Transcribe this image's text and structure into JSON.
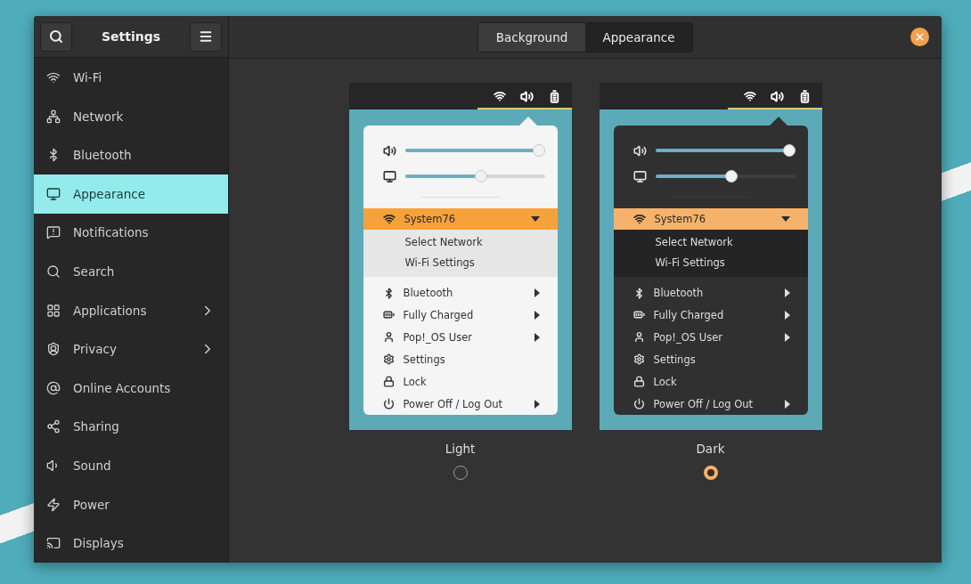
{
  "window": {
    "title": "Settings"
  },
  "sidebar": {
    "items": [
      {
        "label": "Wi-Fi",
        "selected": false,
        "has_submenu": false
      },
      {
        "label": "Network",
        "selected": false,
        "has_submenu": false
      },
      {
        "label": "Bluetooth",
        "selected": false,
        "has_submenu": false
      },
      {
        "label": "Appearance",
        "selected": true,
        "has_submenu": false
      },
      {
        "label": "Notifications",
        "selected": false,
        "has_submenu": false
      },
      {
        "label": "Search",
        "selected": false,
        "has_submenu": false
      },
      {
        "label": "Applications",
        "selected": false,
        "has_submenu": true
      },
      {
        "label": "Privacy",
        "selected": false,
        "has_submenu": true
      },
      {
        "label": "Online Accounts",
        "selected": false,
        "has_submenu": false
      },
      {
        "label": "Sharing",
        "selected": false,
        "has_submenu": false
      },
      {
        "label": "Sound",
        "selected": false,
        "has_submenu": false
      },
      {
        "label": "Power",
        "selected": false,
        "has_submenu": false
      },
      {
        "label": "Displays",
        "selected": false,
        "has_submenu": false
      }
    ]
  },
  "tabs": [
    {
      "label": "Background",
      "selected": false
    },
    {
      "label": "Appearance",
      "selected": true
    }
  ],
  "themes": [
    {
      "kind": "light",
      "label": "Light",
      "selected": false,
      "volume": {
        "level": 1
      },
      "brightness": {
        "level": 0.55
      },
      "network": "System76",
      "network_items": [
        "Select Network",
        "Wi-Fi Settings"
      ],
      "items": [
        {
          "label": "Bluetooth",
          "submenu": true
        },
        {
          "label": "Fully Charged",
          "submenu": true
        },
        {
          "label": "Pop!_OS User",
          "submenu": true
        },
        {
          "label": "Settings",
          "submenu": false
        },
        {
          "label": "Lock",
          "submenu": false
        },
        {
          "label": "Power Off / Log Out",
          "submenu": true
        }
      ]
    },
    {
      "kind": "dark",
      "label": "Dark",
      "selected": true,
      "volume": {
        "level": 1
      },
      "brightness": {
        "level": 0.55
      },
      "network": "System76",
      "network_items": [
        "Select Network",
        "Wi-Fi Settings"
      ],
      "items": [
        {
          "label": "Bluetooth",
          "submenu": true
        },
        {
          "label": "Fully Charged",
          "submenu": true
        },
        {
          "label": "Pop!_OS User",
          "submenu": true
        },
        {
          "label": "Settings",
          "submenu": false
        },
        {
          "label": "Lock",
          "submenu": false
        },
        {
          "label": "Power Off / Log Out",
          "submenu": true
        }
      ]
    }
  ]
}
